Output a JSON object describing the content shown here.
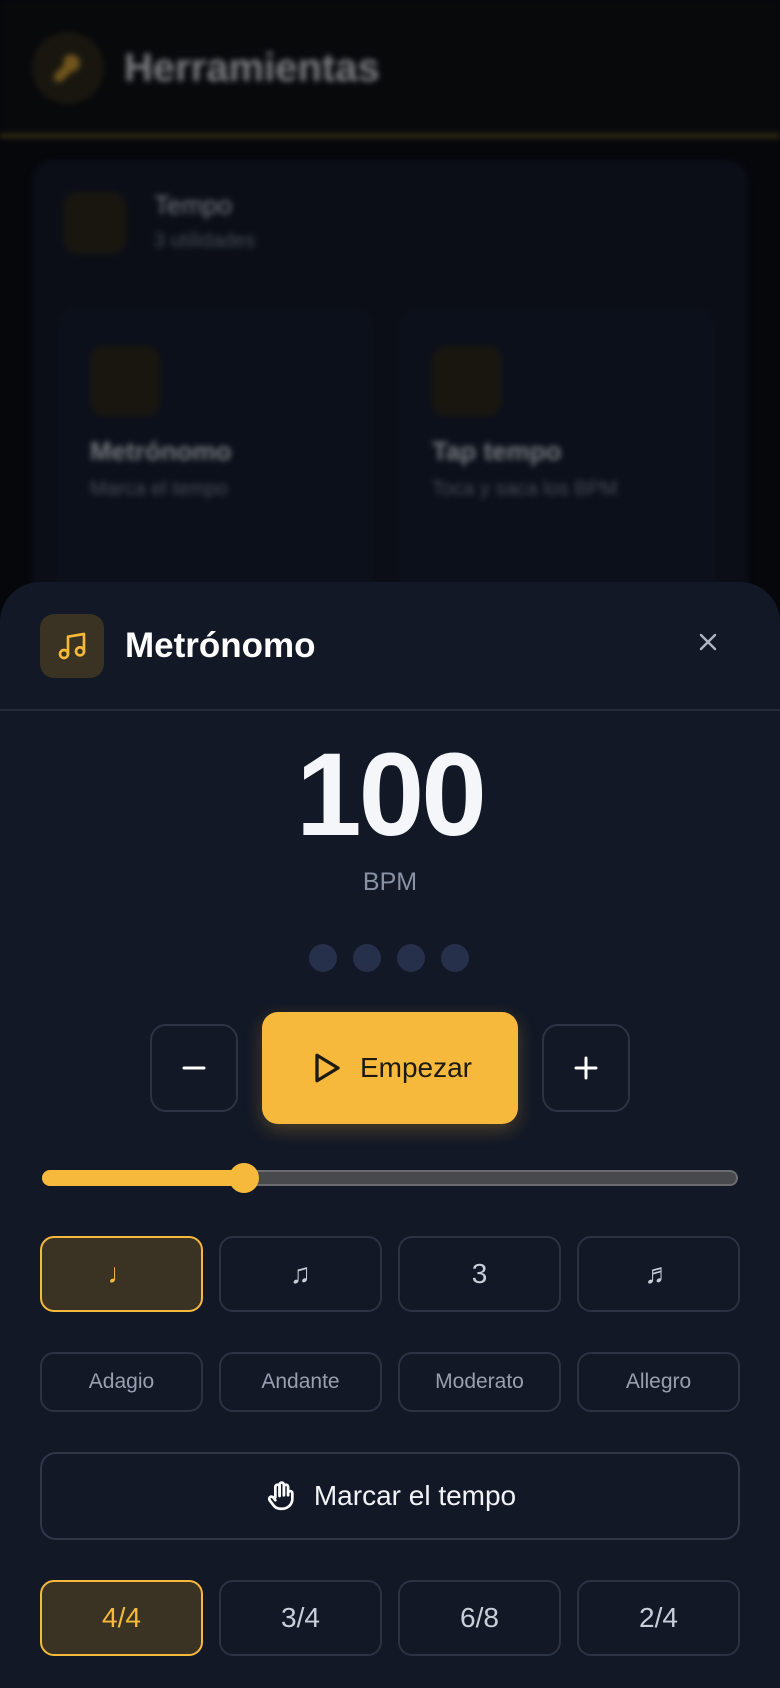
{
  "background": {
    "title": "Herramientas",
    "category": {
      "title": "Tempo",
      "subtitle": "3 utilidades"
    },
    "tiles": [
      {
        "title": "Metrónomo",
        "subtitle": "Marca el tempo"
      },
      {
        "title": "Tap tempo",
        "subtitle": "Toca y saca los BPM"
      }
    ]
  },
  "sheet": {
    "title": "Metrónomo",
    "icon": "music-notes-icon",
    "close_icon": "close-icon"
  },
  "tempo": {
    "value": "100",
    "unit": "BPM",
    "beats": 4,
    "slider_fraction": 0.29
  },
  "controls": {
    "decrement_icon": "minus-icon",
    "increment_icon": "plus-icon",
    "start_label": "Empezar",
    "start_icon": "play-icon"
  },
  "subdivisions": [
    {
      "label": "♩",
      "active": true
    },
    {
      "label": "♫",
      "active": false
    },
    {
      "label": "3",
      "active": false
    },
    {
      "label": "♬",
      "active": false
    }
  ],
  "presets": [
    "Adagio",
    "Andante",
    "Moderato",
    "Allegro"
  ],
  "tap": {
    "label": "Marcar el tempo",
    "icon": "hand-icon"
  },
  "time_signatures": [
    {
      "label": "4/4",
      "active": true
    },
    {
      "label": "3/4",
      "active": false
    },
    {
      "label": "6/8",
      "active": false
    },
    {
      "label": "2/4",
      "active": false
    }
  ],
  "colors": {
    "accent": "#f6b93b",
    "sheet": "#121826"
  }
}
